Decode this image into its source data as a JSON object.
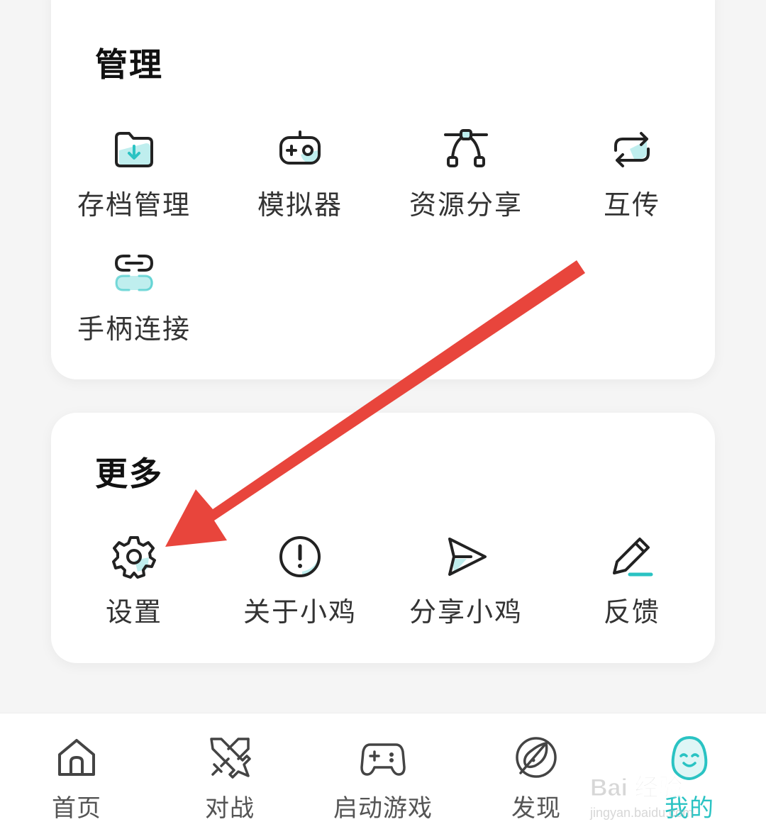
{
  "manage": {
    "title": "管理",
    "items": [
      {
        "label": "存档管理",
        "icon": "folder-download-icon"
      },
      {
        "label": "模拟器",
        "icon": "gamepad-icon"
      },
      {
        "label": "资源分享",
        "icon": "vector-path-icon"
      },
      {
        "label": "互传",
        "icon": "sync-icon"
      },
      {
        "label": "手柄连接",
        "icon": "link-icon"
      }
    ]
  },
  "more": {
    "title": "更多",
    "items": [
      {
        "label": "设置",
        "icon": "gear-icon"
      },
      {
        "label": "关于小鸡",
        "icon": "info-icon"
      },
      {
        "label": "分享小鸡",
        "icon": "send-icon"
      },
      {
        "label": "反馈",
        "icon": "pencil-icon"
      }
    ]
  },
  "bottom_nav": {
    "items": [
      {
        "label": "首页",
        "icon": "home-icon"
      },
      {
        "label": "对战",
        "icon": "crossed-swords-icon"
      },
      {
        "label": "启动游戏",
        "icon": "controller-icon"
      },
      {
        "label": "发现",
        "icon": "compass-leaf-icon"
      },
      {
        "label": "我的",
        "icon": "mascot-icon",
        "active": true
      }
    ]
  },
  "colors": {
    "accent": "#2ac3c3",
    "accent_light": "#bfeeee",
    "arrow": "#e8453c"
  },
  "watermark": {
    "text": "Bai 经验",
    "subtext": "jingyan.baidu.com"
  }
}
